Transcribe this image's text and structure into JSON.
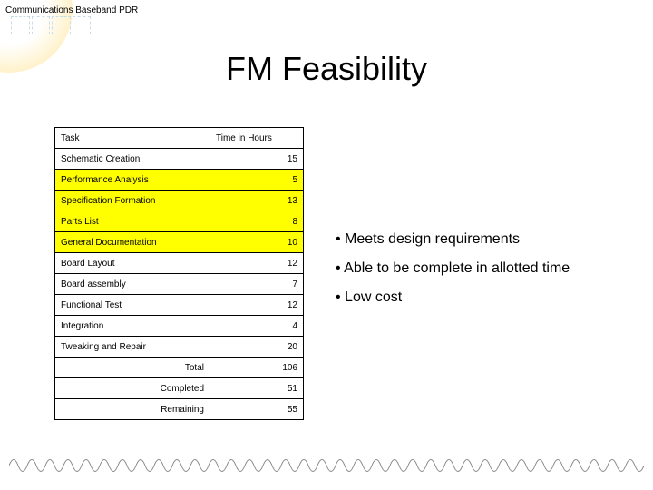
{
  "header": "Communications Baseband PDR",
  "title": "FM Feasibility",
  "table": {
    "header": {
      "task": "Task",
      "time": "Time in Hours"
    },
    "rows": [
      {
        "task": "Schematic Creation",
        "time": "15",
        "hl": false
      },
      {
        "task": "Performance Analysis",
        "time": "5",
        "hl": true
      },
      {
        "task": "Specification Formation",
        "time": "13",
        "hl": true
      },
      {
        "task": "Parts List",
        "time": "8",
        "hl": true
      },
      {
        "task": "General Documentation",
        "time": "10",
        "hl": true
      },
      {
        "task": "Board Layout",
        "time": "12",
        "hl": false
      },
      {
        "task": "Board assembly",
        "time": "7",
        "hl": false
      },
      {
        "task": "Functional Test",
        "time": "12",
        "hl": false
      },
      {
        "task": "Integration",
        "time": "4",
        "hl": false
      },
      {
        "task": "Tweaking and Repair",
        "time": "20",
        "hl": false
      }
    ],
    "totals": [
      {
        "label": "Total",
        "value": "106"
      },
      {
        "label": "Completed",
        "value": "51"
      },
      {
        "label": "Remaining",
        "value": "55"
      }
    ]
  },
  "bullets": [
    "Meets design requirements",
    "Able to be complete in allotted time",
    "Low cost"
  ]
}
